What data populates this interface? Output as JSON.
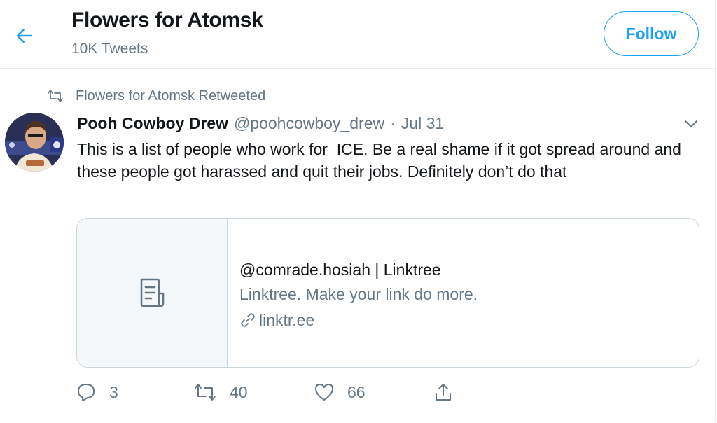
{
  "header": {
    "title": "Flowers for Atomsk",
    "subtitle": "10K Tweets",
    "follow_label": "Follow",
    "back_icon": "arrow-left-icon",
    "accent_color": "#1da1f2"
  },
  "retweet": {
    "label": "Flowers for Atomsk Retweeted",
    "icon": "retweet-icon"
  },
  "tweet": {
    "author_name": "Pooh Cowboy Drew",
    "author_handle": "@poohcowboy_drew",
    "separator": "·",
    "date": "Jul 31",
    "text": "This is a list of people who work for  ICE. Be a real shame if it got spread around and these people got harassed and quit their jobs. Definitely don’t do that",
    "card": {
      "title": "@comrade.hosiah | Linktree",
      "description": "Linktree. Make your link do more.",
      "domain": "linktr.ee",
      "thumb_icon": "document-icon",
      "link_icon": "link-icon"
    },
    "actions": {
      "replies": "3",
      "retweets": "40",
      "likes": "66"
    }
  },
  "colors": {
    "text_primary": "#14171a",
    "text_secondary": "#657786",
    "border": "#e6ecf0"
  }
}
